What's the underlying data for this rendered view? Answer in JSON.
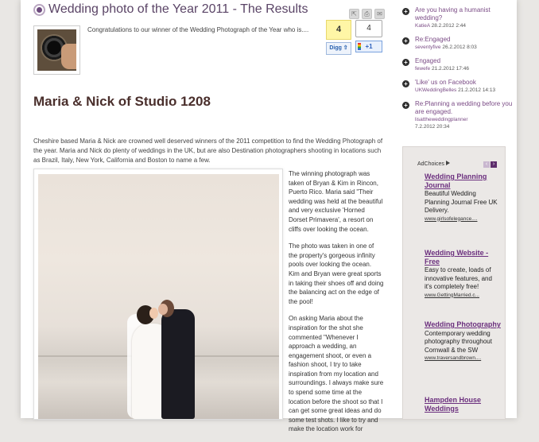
{
  "post": {
    "title": "Wedding photo of the Year 2011 - The Results",
    "excerpt": "Congratulations to our winner of the Wedding Photograph of the Year who is....",
    "share_icons": [
      "share-icon",
      "print-icon",
      "email-icon"
    ]
  },
  "digg": {
    "count": "4",
    "button_label": "Digg ⇧"
  },
  "plusone": {
    "count": "4",
    "button_label": "+1"
  },
  "entry": {
    "title": "Maria & Nick of Studio 1208",
    "lead": "Cheshire based Maria & Nick are crowned well deserved winners of the 2011 competition to find the Wedding Photograph of the year. Maria and Nick do plenty of weddings in the UK, but are also Destination photographers shooting in locations such as Brazil, Italy, New York, California and Boston to name a few.",
    "paragraphs": [
      "The winning photograph was taken of Bryan & Kim in Rincon, Puerto Rico. Maria said \"Their wedding was held at the beautiful and very exclusive 'Horned Dorset Primavera', a resort on cliffs over looking the ocean.",
      "The photo was taken in one of the property's gorgeous infinity pools over looking the ocean.  Kim and Bryan were great sports in taking their shoes off and doing the balancing act on the edge of the pool!",
      "On asking Maria about the inspiration for the shot she commented \"Whenever I approach a wedding, an engagement shoot, or even a fashion shoot, I try to take inspiration from my location and surroundings.  I always make sure to spend some time at the location before the shoot so that I can get some great ideas and do some test shots.  I like to try and make the location work for"
    ]
  },
  "sidebar": {
    "recent": [
      {
        "title": "Are you having a humanist wedding?",
        "user": "KatieA",
        "date": "28.2.2012 2:44"
      },
      {
        "title": "Re:Engaged",
        "user": "seventyfive",
        "date": "26.2.2012 8:03"
      },
      {
        "title": "Engaged",
        "user": "fewefe",
        "date": "21.2.2012 17:46"
      },
      {
        "title": "'Like' us on Facebook",
        "user": "UKWeddingBelles",
        "date": "21.2.2012 14:13"
      },
      {
        "title": "Re:Planning a wedding before you are engaged.",
        "user": "lisattheweddingplanner",
        "date": "7.2.2012 20:34"
      }
    ]
  },
  "ads": {
    "adchoices_label": "AdChoices",
    "nav_prev": "‹",
    "nav_next": "›",
    "items": [
      {
        "title": "Wedding Planning Journal",
        "desc": "Beautiful Wedding Planning Journal Free UK Delivery.",
        "url": "www.girlsofelegance...."
      },
      {
        "title": "Wedding Website - Free",
        "desc": "Easy to create, loads of innovative features, and it's completely free!",
        "url": "www.GettingMarried.c..."
      },
      {
        "title": "Wedding Photography",
        "desc": "Contemporary wedding photography throughout Cornwall & the SW",
        "url": "www.traversandbrown...."
      },
      {
        "title": "Hampden House Weddings",
        "desc": "",
        "url": ""
      }
    ]
  }
}
